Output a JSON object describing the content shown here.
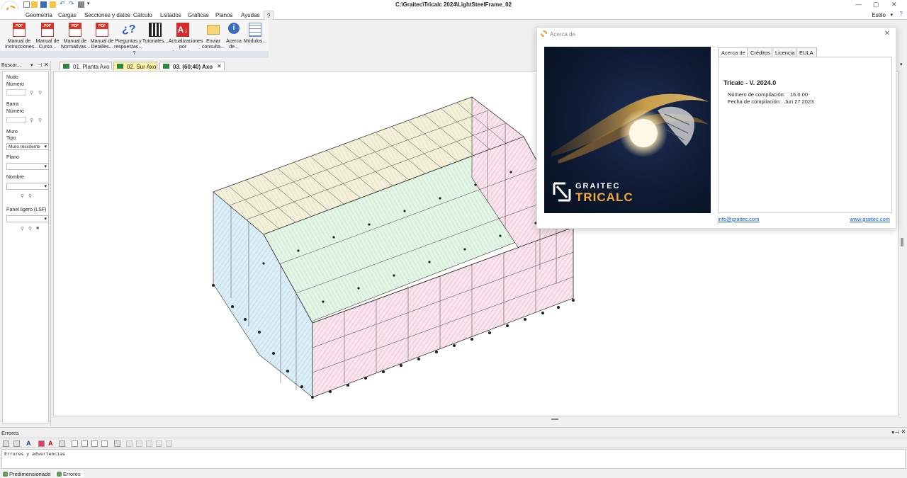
{
  "window": {
    "title": "C:\\Graitec\\Tricalc 2024\\LightSteelFrame_02"
  },
  "menu": {
    "items": [
      "Geometría",
      "Cargas",
      "Secciones y datos",
      "Cálculo",
      "Listados",
      "Gráficas",
      "Planos",
      "Ayudas",
      "?"
    ],
    "estilo": "Estilo"
  },
  "ribbon": {
    "buttons": [
      {
        "label": "Manual de Instrucciones...",
        "icon": "pdf-icon"
      },
      {
        "label": "Manual de Curso...",
        "icon": "pdf-icon"
      },
      {
        "label": "Manual de Normativas...",
        "icon": "pdf-icon"
      },
      {
        "label": "Manual de Detalles...",
        "icon": "pdf-icon"
      },
      {
        "label": "Preguntas y respuestas...",
        "icon": "faq-icon"
      },
      {
        "label": "Tutoriales...",
        "icon": "clapperboard-icon"
      },
      {
        "label": "Actualizaciones por Internet...",
        "icon": "update-icon"
      },
      {
        "label": "Enviar consulta...",
        "icon": "envelope-icon"
      },
      {
        "label": "Acerca de...",
        "icon": "info-icon"
      },
      {
        "label": "Módulos...",
        "icon": "table-icon"
      }
    ],
    "group_label": "?"
  },
  "doc_tabs": [
    {
      "label": "01. Planta   Axo"
    },
    {
      "label": "02. Sur   Axo"
    },
    {
      "label": "03.  (60;40)  Axo"
    }
  ],
  "left_panel": {
    "title": "Buscar...",
    "nudo": "Nudo",
    "nudo_numero": "Número",
    "barra": "Barra",
    "barra_numero": "Número",
    "muro": "Muro",
    "tipo": "Tipo",
    "tipo_value": "Muro resistente",
    "plano": "Plano",
    "nombre": "Nombre",
    "panel_ligero": "Panel ligero (LSF)"
  },
  "about": {
    "header": "Acerca de",
    "tabs": [
      "Acerca de",
      "Créditos",
      "Licencia",
      "EULA"
    ],
    "product": "Tricalc - V. 2024.0",
    "build_label": "Número de compilación:",
    "build_value": "16.0.00",
    "date_label": "Fecha de compilación:",
    "date_value": "Jun 27 2023",
    "email": "info@graitec.com",
    "website": "www.graitec.com",
    "logo_top": "GRAITEC",
    "logo_bottom": "TRICALC"
  },
  "errors_panel": {
    "title": "Errores",
    "content": "Errores y advertencias"
  },
  "bottom_tabs": [
    "Predimensionado",
    "Errores"
  ],
  "colors": {
    "accent": "#f29b1d",
    "tab_selected": "#fff3a8",
    "link": "#1a5cc8"
  }
}
